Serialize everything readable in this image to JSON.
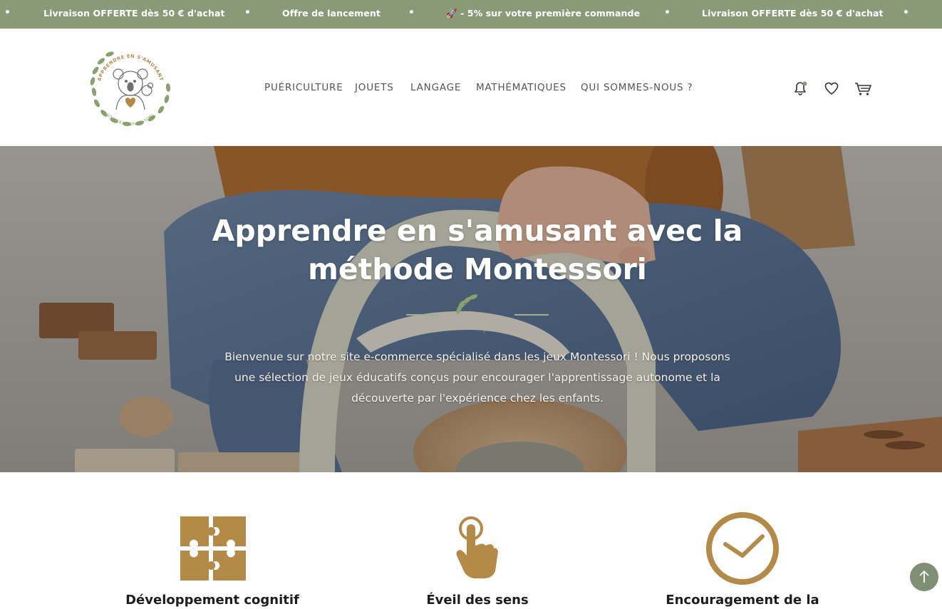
{
  "announcement": {
    "items": [
      "Livraison OFFERTE dès 50 € d'achat",
      "Offre de lancement",
      "🚀 - 5% sur votre première commande",
      "Livraison OFFERTE dès 50 € d'achat"
    ],
    "separator": "•"
  },
  "header": {
    "logo": {
      "top_text": "APPRENDRE EN S'AMUSANT",
      "bottom_text": "UNIVERS MONTESSORI",
      "icon": "koala-logo"
    },
    "nav": [
      "PUÉRICULTURE",
      "JOUETS",
      "LANGAGE",
      "MATHÉMATIQUES",
      "QUI SOMMES-NOUS ?"
    ],
    "icons": [
      "bell-icon",
      "heart-icon",
      "cart-icon"
    ]
  },
  "hero": {
    "title_line1": "Apprendre en s'amusant avec la",
    "title_line2": "méthode Montessori",
    "paragraph_line1": "Bienvenue sur notre site e-commerce spécialisé dans les jeux Montessori ! Nous proposons",
    "paragraph_line2": "une sélection de jeux éducatifs conçus pour encourager l'apprentissage autonome et la",
    "paragraph_line3": "découverte par l'expérience chez les enfants."
  },
  "features": [
    {
      "title": "Développement cognitif",
      "icon": "puzzle-icon"
    },
    {
      "title": "Éveil des sens",
      "icon": "touch-hand-icon"
    },
    {
      "title": "Encouragement de la",
      "icon": "clock-icon"
    }
  ],
  "colors": {
    "topbar": "#8a9a78",
    "accent_gold": "#b48a48",
    "sage": "#7e8f73",
    "nav_text": "#555555"
  }
}
